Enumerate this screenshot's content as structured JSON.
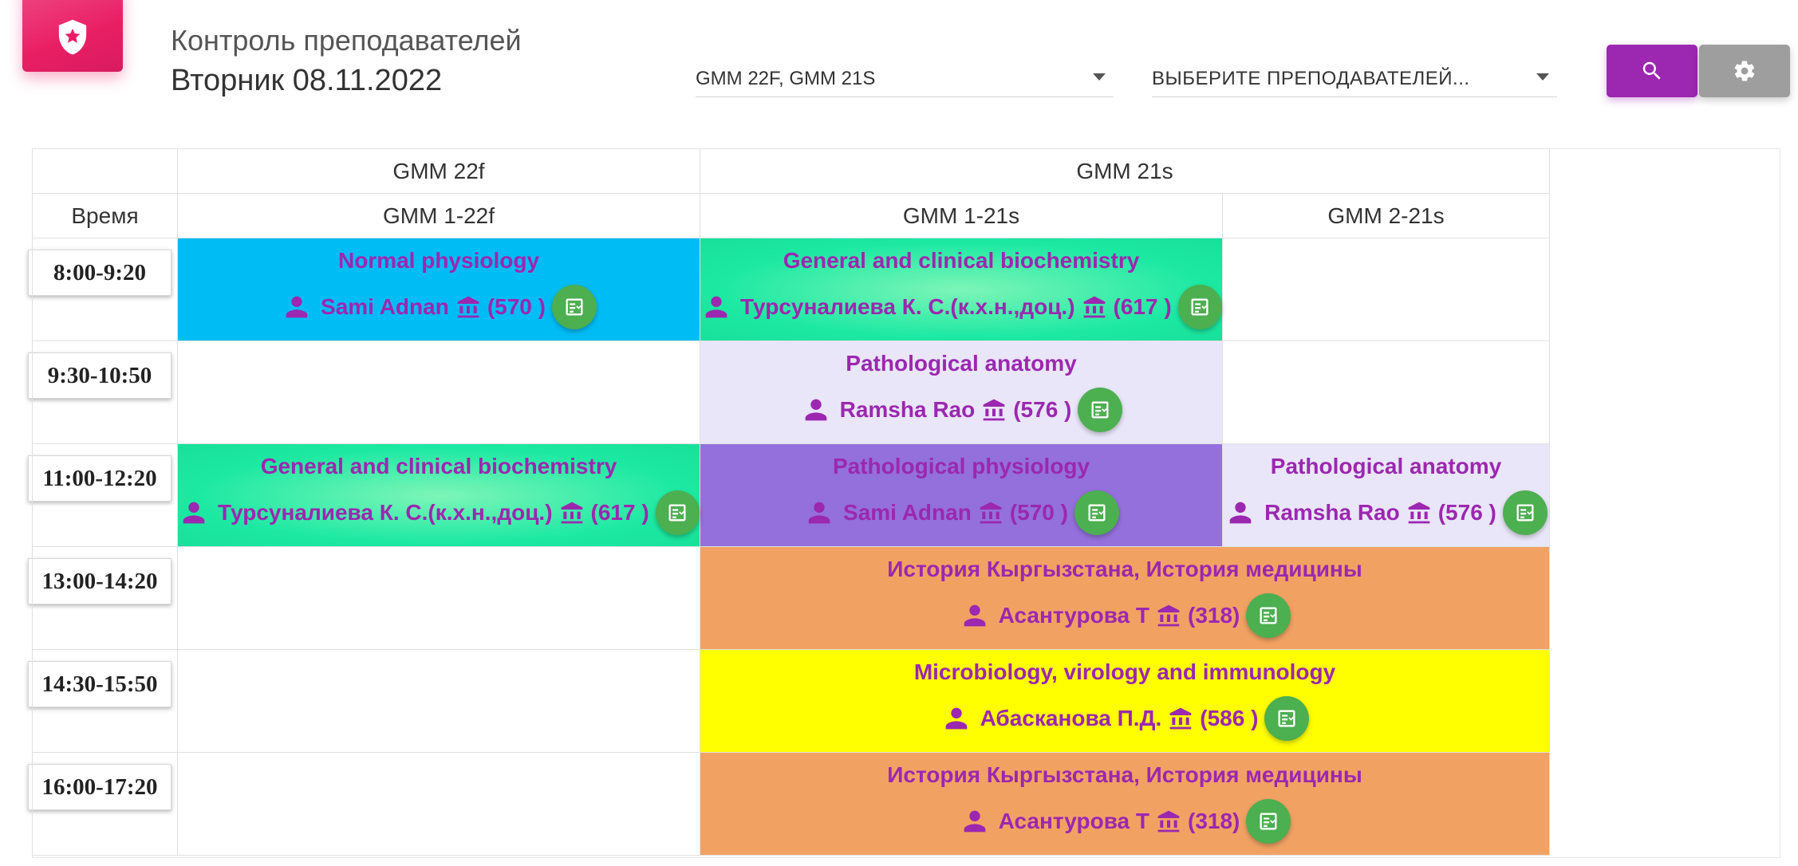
{
  "header": {
    "title": "Контроль преподавателей",
    "date": "Вторник 08.11.2022",
    "groups_select": "GMM 22F, GMM 21S",
    "teachers_placeholder": "ВЫБЕРИТЕ ПРЕПОДАВАТЕЛЕЙ..."
  },
  "colors": {
    "accent": "#9c27b0",
    "brand": "#e91e63",
    "journal": "#4caf50"
  },
  "table": {
    "time_header": "Время",
    "group_headers": [
      "GMM 22f",
      "GMM 21s"
    ],
    "subgroup_headers": [
      "GMM 1-22f",
      "GMM 1-21s",
      "GMM 2-21s"
    ],
    "times": [
      "8:00-9:20",
      "9:30-10:50",
      "11:00-12:20",
      "13:00-14:20",
      "14:30-15:50",
      "16:00-17:20"
    ],
    "lessons": [
      {
        "subject": "Normal physiology",
        "teacher": "Sami Adnan",
        "room": "(570 )"
      },
      {
        "subject": "General and clinical biochemistry",
        "teacher": "Турсуналиева К. С.(к.х.н.,доц.)",
        "room": "(617 )"
      },
      {
        "subject": "Pathological anatomy",
        "teacher": "Ramsha Rao",
        "room": "(576 )"
      },
      {
        "subject": "General and clinical biochemistry",
        "teacher": "Турсуналиева К. С.(к.х.н.,доц.)",
        "room": "(617 )"
      },
      {
        "subject": "Pathological physiology",
        "teacher": "Sami Adnan",
        "room": "(570 )"
      },
      {
        "subject": "Pathological anatomy",
        "teacher": "Ramsha Rao",
        "room": "(576 )"
      },
      {
        "subject": "История Кыргызстана, История медицины",
        "teacher": "Асантурова Т",
        "room": "(318)"
      },
      {
        "subject": "Microbiology, virology and immunology",
        "teacher": "Абасканова П.Д.",
        "room": "(586 )"
      },
      {
        "subject": "История Кыргызстана, История медицины",
        "teacher": "Асантурова Т",
        "room": "(318)"
      }
    ]
  }
}
